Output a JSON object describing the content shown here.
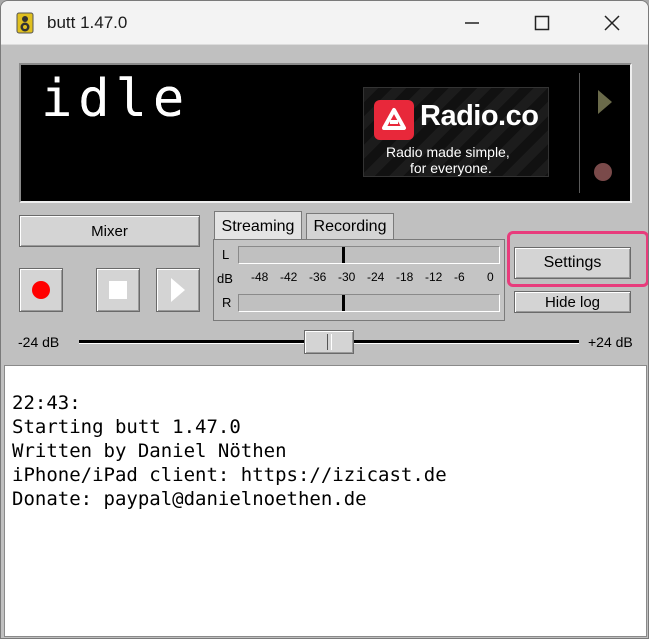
{
  "window": {
    "title": "butt 1.47.0"
  },
  "display": {
    "status": "idle",
    "banner": {
      "brand": "Radio.co",
      "tagline_1": "Radio made simple,",
      "tagline_2": "for everyone."
    }
  },
  "controls": {
    "mixer_label": "Mixer",
    "settings_label": "Settings",
    "hide_log_label": "Hide log"
  },
  "tabs": [
    {
      "label": "Streaming",
      "active": true
    },
    {
      "label": "Recording",
      "active": false
    }
  ],
  "vu_meter": {
    "left_label": "L",
    "db_label": "dB",
    "right_label": "R",
    "scale": [
      "-48",
      "-42",
      "-36",
      "-30",
      "-24",
      "-18",
      "-12",
      "-6",
      "0"
    ]
  },
  "gain_slider": {
    "min_label": "-24 dB",
    "max_label": "+24 dB",
    "value_fraction": 0.5
  },
  "log": {
    "lines": [
      "22:43:",
      "Starting butt 1.47.0",
      "Written by Daniel Nöthen",
      "iPhone/iPad client: https://izicast.de",
      "Donate: paypal@danielnoethen.de"
    ]
  },
  "colors": {
    "record_red": "#ff0000",
    "highlight_pink": "#e83c7c",
    "brand_red": "#e8283a"
  },
  "icons": {
    "app": "speaker-icon",
    "minimize": "minimize-icon",
    "maximize": "maximize-icon",
    "close": "close-icon",
    "record": "record-icon",
    "stop": "stop-icon",
    "play": "play-icon"
  }
}
